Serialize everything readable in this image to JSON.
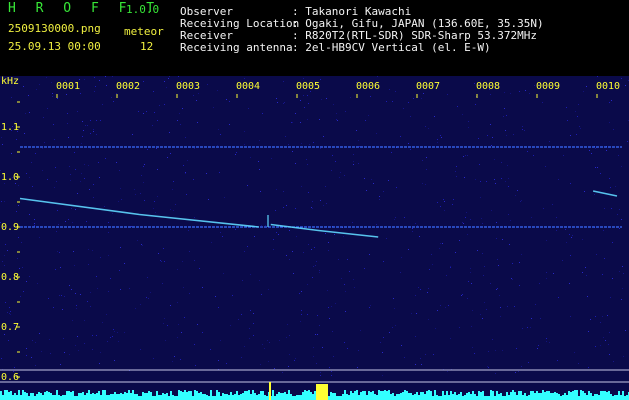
{
  "header": {
    "logo": "H R O F F T",
    "version": "1.0.0",
    "filename": "2509130000.png",
    "meteor_label": "meteor",
    "datetime": "25.09.13 00:00",
    "meteor_count": "12",
    "fields": [
      {
        "label": "Observer",
        "value": ": Takanori Kawachi"
      },
      {
        "label": "Receiving Location",
        "value": ": Ogaki, Gifu, JAPAN (136.60E, 35.35N)"
      },
      {
        "label": "Receiver",
        "value": ": R820T2(RTL-SDR) SDR-Sharp 53.372MHz"
      },
      {
        "label": "Receiving antenna",
        "value": ": 2el-HB9CV Vertical (el. E-W)"
      }
    ]
  },
  "chart_data": {
    "type": "heatmap",
    "ylabel": "kHz",
    "y_ticks": [
      "1.1",
      "1.0",
      "0.9",
      "0.8",
      "0.7",
      "0.6"
    ],
    "x_ticks": [
      "0001",
      "0002",
      "0003",
      "0004",
      "0005",
      "0006",
      "0007",
      "0008",
      "0009",
      "0010"
    ],
    "ylim": [
      0.58,
      1.19
    ],
    "xlim": [
      0,
      10
    ],
    "carrier_lines_khz": [
      1.06,
      0.9
    ],
    "meteor_traces": [
      {
        "x": [
          0.0,
          2.0,
          4.0
        ],
        "y": [
          0.957,
          0.925,
          0.9
        ]
      },
      {
        "x": [
          4.2,
          5.0,
          6.0
        ],
        "y": [
          0.905,
          0.893,
          0.88
        ]
      },
      {
        "x": [
          9.6,
          10.0
        ],
        "y": [
          0.972,
          0.962
        ]
      }
    ],
    "colors": {
      "background": "#0a0a4a",
      "trace": "#5fd7ff",
      "axis_text": "#ffff33",
      "floor": "#33ffff"
    }
  }
}
